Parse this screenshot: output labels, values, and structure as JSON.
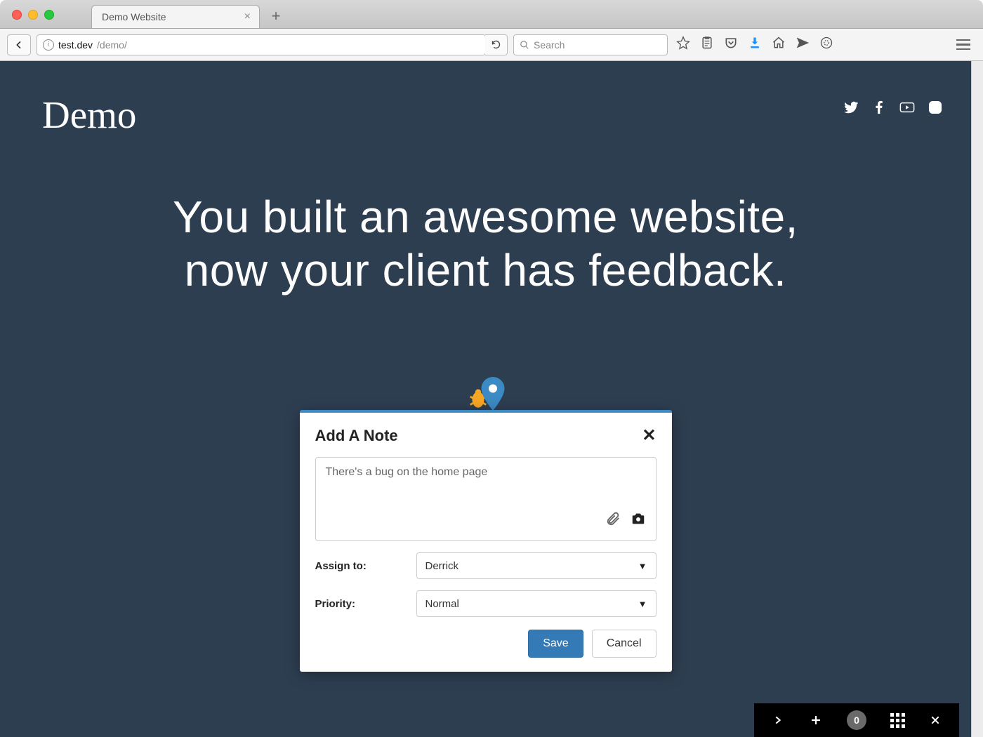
{
  "browser": {
    "tab_title": "Demo Website",
    "url_host": "test.dev",
    "url_path": "/demo/",
    "search_placeholder": "Search"
  },
  "page": {
    "logo": "Demo",
    "hero_line1": "You built an awesome website,",
    "hero_line2": "now your client has feedback."
  },
  "modal": {
    "title": "Add A Note",
    "note_text": "There's a bug on the home page",
    "assign_label": "Assign to:",
    "assign_value": "Derrick",
    "priority_label": "Priority:",
    "priority_value": "Normal",
    "save_label": "Save",
    "cancel_label": "Cancel"
  },
  "bottombar": {
    "count": "0"
  }
}
